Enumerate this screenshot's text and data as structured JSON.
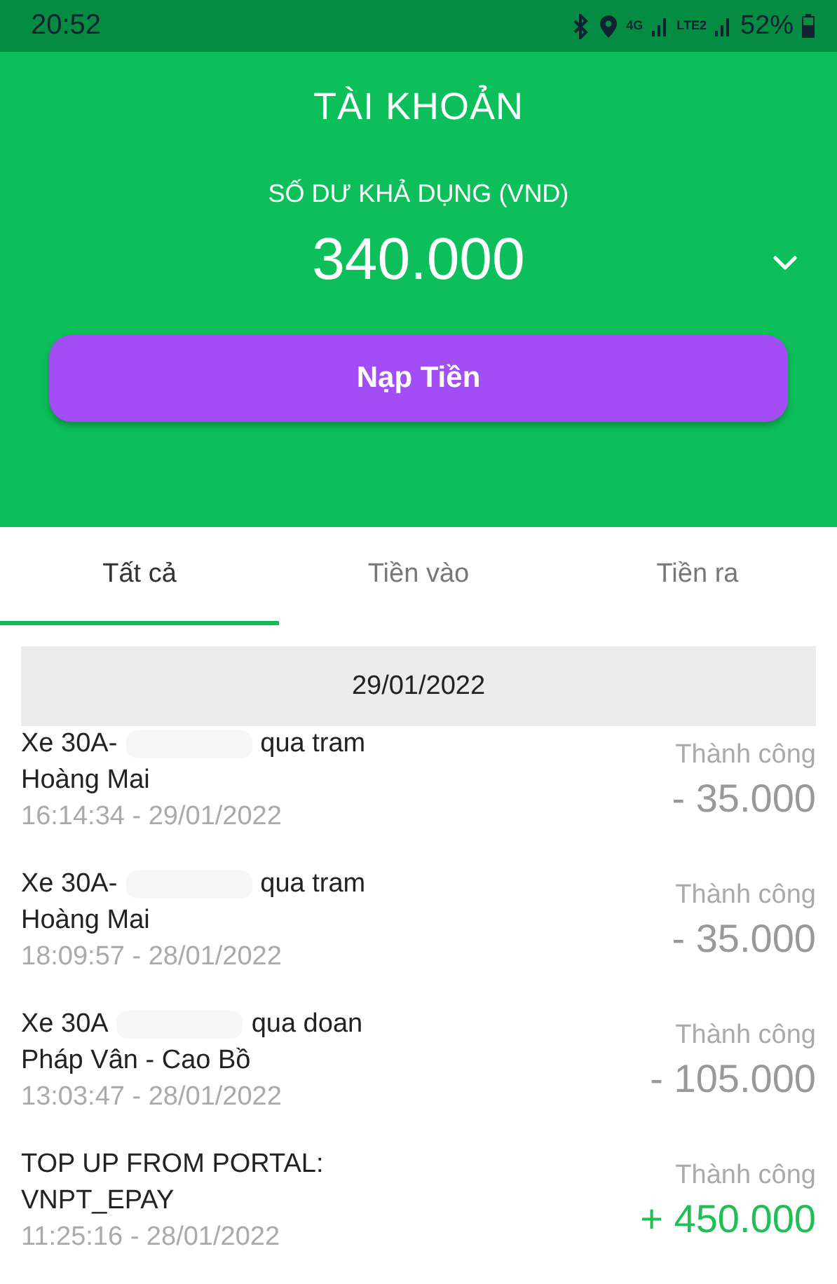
{
  "status_bar": {
    "time": "20:52",
    "network_label": "4G",
    "sim2_label": "LTE2",
    "battery": "52%"
  },
  "header": {
    "title": "TÀI KHOẢN",
    "balance_label": "SỐ DƯ KHẢ DỤNG (VND)",
    "balance": "340.000",
    "button": "Nạp Tiền"
  },
  "tabs": [
    {
      "label": "Tất cả",
      "selected": true
    },
    {
      "label": "Tiền vào",
      "selected": false
    },
    {
      "label": "Tiền ra",
      "selected": false
    }
  ],
  "date_header": "29/01/2022",
  "transactions": [
    {
      "kind": "redacted",
      "title_start": "Xe 30A-",
      "title_end": "qua tram",
      "title_line2": "Hoàng Mai",
      "time": "16:14:34 - 29/01/2022",
      "status": "Thành công",
      "credit": false,
      "amount": "- 35.000"
    },
    {
      "kind": "redacted",
      "title_start": "Xe 30A-",
      "title_end": "qua tram",
      "title_line2": "Hoàng Mai",
      "time": "18:09:57 - 28/01/2022",
      "status": "Thành công",
      "credit": false,
      "amount": "- 35.000"
    },
    {
      "kind": "redacted",
      "title_start": "Xe 30A",
      "title_end": "qua doan",
      "title_line2": "Pháp Vân - Cao Bồ",
      "time": "13:03:47 - 28/01/2022",
      "status": "Thành công",
      "credit": false,
      "amount": "- 105.000"
    },
    {
      "kind": "plain",
      "title_start": "TOP UP FROM PORTAL:",
      "title_line2": "VNPT_EPAY",
      "time": "11:25:16 - 28/01/2022",
      "status": "Thành công",
      "credit": true,
      "amount": "+ 450.000"
    }
  ]
}
